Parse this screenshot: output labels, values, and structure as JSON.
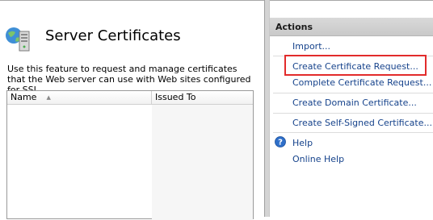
{
  "page": {
    "title": "Server Certificates",
    "description": "Use this feature to request and manage certificates that the Web server can use with Web sites configured for SSL."
  },
  "grid": {
    "columns": [
      "Name",
      "Issued To"
    ],
    "rows": []
  },
  "actions": {
    "title": "Actions",
    "items": [
      "Import...",
      "Create Certificate Request...",
      "Complete Certificate Request...",
      "Create Domain Certificate...",
      "Create Self-Signed Certificate...",
      "Help",
      "Online Help"
    ]
  },
  "colors": {
    "link": "#15428b",
    "highlight": "#e22b2b"
  }
}
